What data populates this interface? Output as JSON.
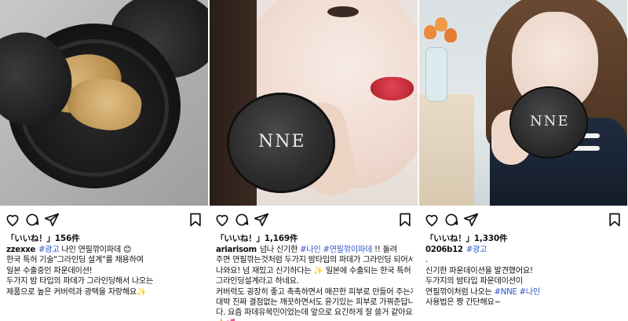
{
  "posts": [
    {
      "likes": "「いいね！」156件",
      "caption_lines": [
        {
          "user": "zzexxe",
          "tag": "#광고",
          "text": "나인 연필깎이파데 😊"
        },
        {
          "text": "한국 특허 기술\"그라인딩 설계\"를 채용하여"
        },
        {
          "text": "일본 수출중인 파운데이션!"
        },
        {
          "text": "두가지 밤 타입의 파데가 그라인딩해서 나오는"
        },
        {
          "text": "제품으로 높은 커버력과 광택을 자랑해요✨"
        }
      ]
    },
    {
      "likes": "「いいね！」1,169件",
      "caption_lines": [
        {
          "user": "ariarisom",
          "text": "넘나 신기한",
          "tag": "#나인",
          "tag2": "#연필깎이파데",
          "text2": "!! 돌려"
        },
        {
          "text": "주면 연필깎는것처럼 두가지 밤타입의 파데가 그라인딩 되어서"
        },
        {
          "text": "나와요! 넘 재밌고 신기하다는 ✨ 일본에 수출되는 한국 특허"
        },
        {
          "text": "그라인딩설계라고 하네요."
        },
        {
          "text": "커버력도 굉장히 좋고 촉촉하면서 매끈한 피부로 만들어 주는게"
        },
        {
          "text": "대박 진짜 결점없는 깨끗하면서도 윤기있는 피부로 가꿔준답니"
        },
        {
          "text": "다. 요즘 파데유목민이었는데 앞으로 요긴하게 잘 쓸거 같아요"
        },
        {
          "text": "👍💕"
        }
      ]
    },
    {
      "likes": "「いいね！」1,330件",
      "caption_lines": [
        {
          "user": "0206b12",
          "tag": "#광고"
        },
        {
          "text": "."
        },
        {
          "text": "신기한 파운데이션을 발견했어요!"
        },
        {
          "text": "두가지의 밤타입 파운데이션이"
        },
        {
          "text": "연필깎이처럼 나오는",
          "tag": "#NNE",
          "tag2": "#나인"
        },
        {
          "text": "사용법은 짱 간단해요~"
        }
      ]
    }
  ],
  "product_logo": "NNE",
  "icons": [
    "heart-icon",
    "comment-icon",
    "share-icon",
    "bookmark-icon"
  ]
}
